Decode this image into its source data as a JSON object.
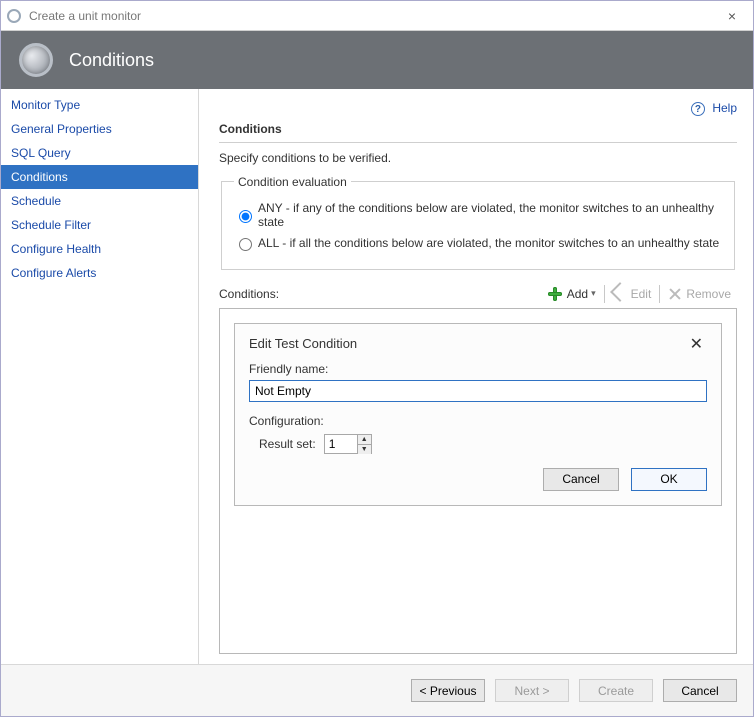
{
  "window": {
    "title": "Create a unit monitor",
    "close": "×"
  },
  "banner": {
    "title": "Conditions"
  },
  "sidebar": {
    "items": [
      {
        "label": "Monitor Type"
      },
      {
        "label": "General Properties"
      },
      {
        "label": "SQL Query"
      },
      {
        "label": "Conditions",
        "active": true
      },
      {
        "label": "Schedule"
      },
      {
        "label": "Schedule Filter"
      },
      {
        "label": "Configure Health"
      },
      {
        "label": "Configure Alerts"
      }
    ]
  },
  "help": {
    "label": "Help",
    "icon_glyph": "?"
  },
  "main": {
    "section_title": "Conditions",
    "subtext": "Specify conditions to be verified.",
    "eval_legend": "Condition evaluation",
    "radio_any": "ANY - if any of the conditions below are violated, the monitor switches to an unhealthy state",
    "radio_all": "ALL - if all the conditions below are violated, the monitor switches to an unhealthy state",
    "radio_value": "any",
    "conditions_label": "Conditions:"
  },
  "toolbar": {
    "add": "Add",
    "edit": "Edit",
    "remove": "Remove"
  },
  "dialog": {
    "title": "Edit Test Condition",
    "close": "✕",
    "friendly_label": "Friendly name:",
    "friendly_value": "Not Empty",
    "config_label": "Configuration:",
    "resultset_label": "Result set:",
    "resultset_value": "1",
    "ok": "OK",
    "cancel": "Cancel"
  },
  "footer": {
    "previous": "< Previous",
    "next": "Next >",
    "create": "Create",
    "cancel": "Cancel"
  }
}
